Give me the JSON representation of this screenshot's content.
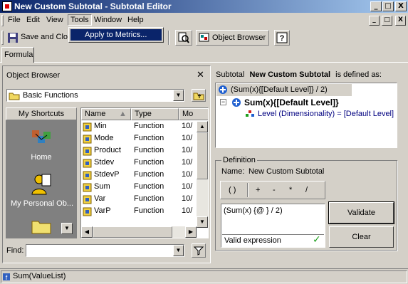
{
  "window": {
    "title": "New Custom Subtotal - Subtotal Editor"
  },
  "titlebar_buttons": {
    "minimize": "_",
    "maximize": "□",
    "close": "X"
  },
  "menu": {
    "file": "File",
    "edit": "Edit",
    "view": "View",
    "tools": "Tools",
    "window": "Window",
    "help": "Help"
  },
  "dropdown": {
    "apply_to_metrics": "Apply to Metrics..."
  },
  "toolbar": {
    "save_close": "Save and Clo",
    "object_browser": "Object Browser"
  },
  "tabs": {
    "formula": "Formula"
  },
  "object_browser": {
    "title": "Object Browser",
    "folder": "Basic Functions",
    "shortcuts_label": "My Shortcuts",
    "shortcut_home": "Home",
    "shortcut_personal": "My Personal Ob...",
    "columns": {
      "name": "Name",
      "type": "Type",
      "modified": "Mo"
    },
    "rows": [
      {
        "name": "Min",
        "type": "Function",
        "mod": "10/"
      },
      {
        "name": "Mode",
        "type": "Function",
        "mod": "10/"
      },
      {
        "name": "Product",
        "type": "Function",
        "mod": "10/"
      },
      {
        "name": "Stdev",
        "type": "Function",
        "mod": "10/"
      },
      {
        "name": "StdevP",
        "type": "Function",
        "mod": "10/"
      },
      {
        "name": "Sum",
        "type": "Function",
        "mod": "10/"
      },
      {
        "name": "Var",
        "type": "Function",
        "mod": "10/"
      },
      {
        "name": "VarP",
        "type": "Function",
        "mod": "10/"
      }
    ],
    "find_label": "Find:",
    "find_value": ""
  },
  "subtotal": {
    "prefix": "Subtotal",
    "name": "New Custom Subtotal",
    "suffix": "is defined as:",
    "tree": {
      "root": "(Sum(x){[Default Level]} / 2)",
      "child": "Sum(x){[Default Level]}",
      "grandchild": "Level (Dimensionality) = [Default Level]"
    }
  },
  "definition": {
    "group_label": "Definition",
    "name_label": "Name:",
    "name_value": "New Custom Subtotal",
    "operators": [
      "( )",
      "+",
      "-",
      "*",
      "/"
    ],
    "expression": "(Sum(x) {@ } / 2)",
    "status": "Valid expression",
    "validate": "Validate",
    "clear": "Clear"
  },
  "status_bar": {
    "text": "Sum(ValueList)"
  }
}
